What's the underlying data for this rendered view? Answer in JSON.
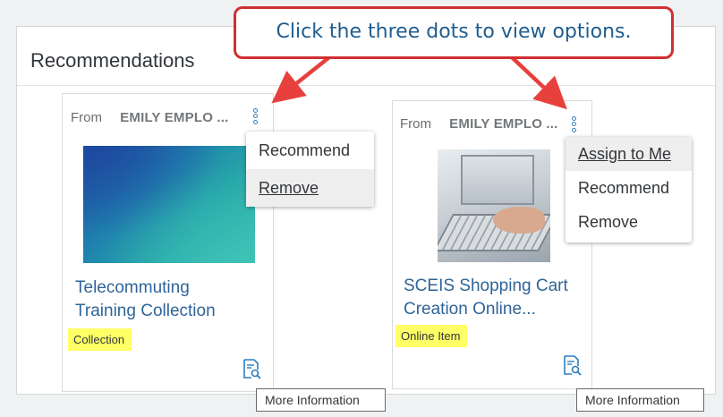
{
  "panel": {
    "title": "Recommendations"
  },
  "callout": {
    "text": "Click the three dots to view options."
  },
  "cards": [
    {
      "from_label": "From",
      "from_name": "EMILY EMPLO ...",
      "title_line1": "Telecommuting",
      "title_line2": "Training Collection",
      "type": "Collection",
      "menu": [
        "Recommend",
        "Remove"
      ],
      "tooltip": "More Information"
    },
    {
      "from_label": "From",
      "from_name": "EMILY EMPLO ...",
      "title_line1": "SCEIS Shopping Cart",
      "title_line2": "Creation Online...",
      "type": "Online Item",
      "menu": [
        "Assign to Me",
        "Recommend",
        "Remove"
      ],
      "tooltip": "More Information"
    }
  ],
  "colors": {
    "accent": "#2d7ec0",
    "title_link": "#2f6497",
    "highlight": "#ffff66",
    "callout_border": "#d12f32",
    "arrow": "#e8403d"
  },
  "icons": {
    "more_options": "three-dots-vertical-icon",
    "more_information": "document-search-icon"
  }
}
